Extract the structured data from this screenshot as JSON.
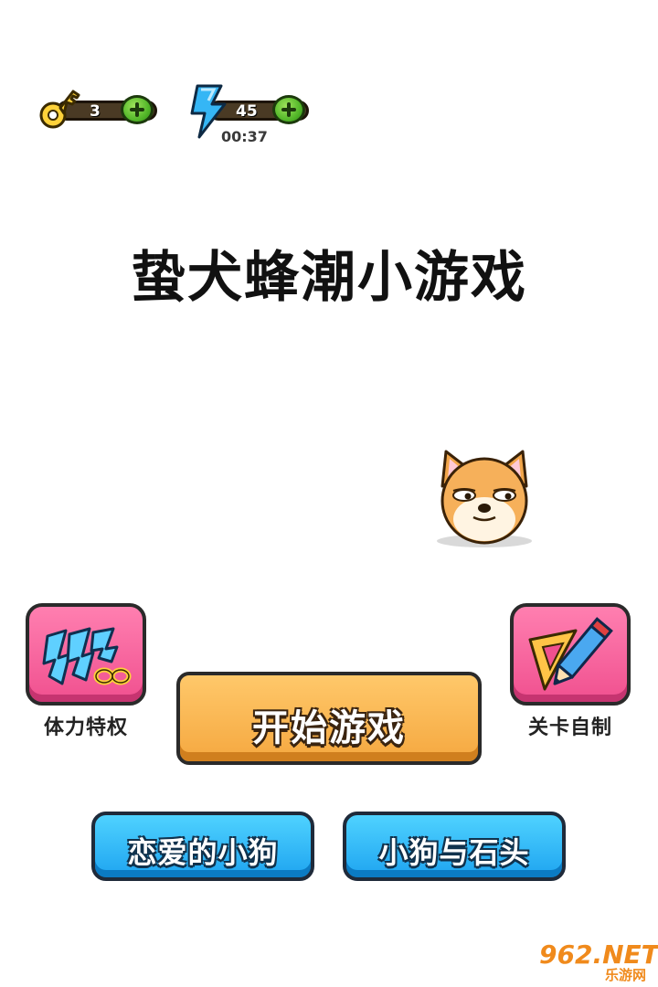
{
  "resources": {
    "keys": {
      "icon": "key-icon",
      "count": "3",
      "add_icon": "plus-icon"
    },
    "energy": {
      "icon": "lightning-icon",
      "count": "45",
      "timer": "00:37",
      "add_icon": "plus-icon"
    }
  },
  "title": {
    "part1": "蛰犬蜂潮",
    "part2": "小游戏"
  },
  "mascot": {
    "icon": "shiba-dog-face-icon"
  },
  "buttons": {
    "stamina": {
      "label": "体力特权",
      "icon": "infinite-energy-icon",
      "color": "#f0508f"
    },
    "start": {
      "label": "开始游戏",
      "color": "#f5a840"
    },
    "editor": {
      "label": "关卡自制",
      "icon": "ruler-pencil-icon",
      "color": "#f0508f"
    },
    "love_dog": {
      "label": "恋爱的小狗",
      "color": "#1ea4f0"
    },
    "dog_stone": {
      "label": "小狗与石头",
      "color": "#1ea4f0"
    }
  },
  "watermark": {
    "main": "962.NET",
    "sub": "乐游网"
  }
}
